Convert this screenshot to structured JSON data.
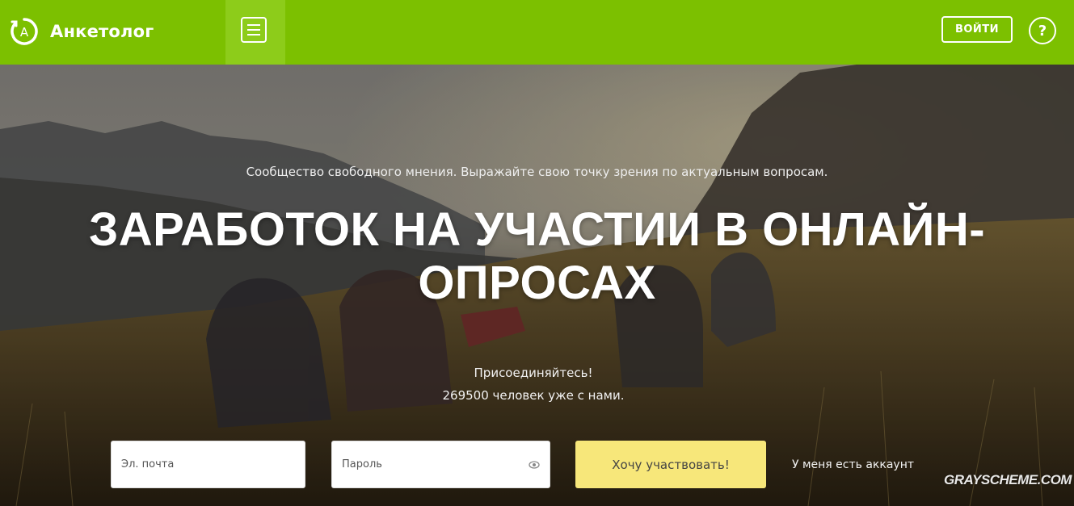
{
  "header": {
    "logo_letter": "A",
    "logo_text": "Анкетолог",
    "login_label": "ВОЙТИ",
    "help_label": "?"
  },
  "hero": {
    "tagline": "Сообщество свободного мнения. Выражайте свою точку зрения по актуальным вопросам.",
    "headline_line1": "ЗАРАБОТОК НА УЧАСТИИ В ОНЛАЙН-",
    "headline_line2": "ОПРОСАХ",
    "join_line1": "Присоединяйтесь!",
    "join_line2": "269500 человек уже с нами."
  },
  "form": {
    "email_placeholder": "Эл. почта",
    "password_placeholder": "Пароль",
    "submit_label": "Хочу участвовать!",
    "have_account_label": "У меня есть аккаунт"
  },
  "watermark": "GRAYSCHEME.COM",
  "colors": {
    "brand_green": "#7cc000",
    "cta_yellow": "#f7e77a"
  },
  "icons": [
    "logo-mark-icon",
    "menu-icon",
    "eye-icon"
  ]
}
